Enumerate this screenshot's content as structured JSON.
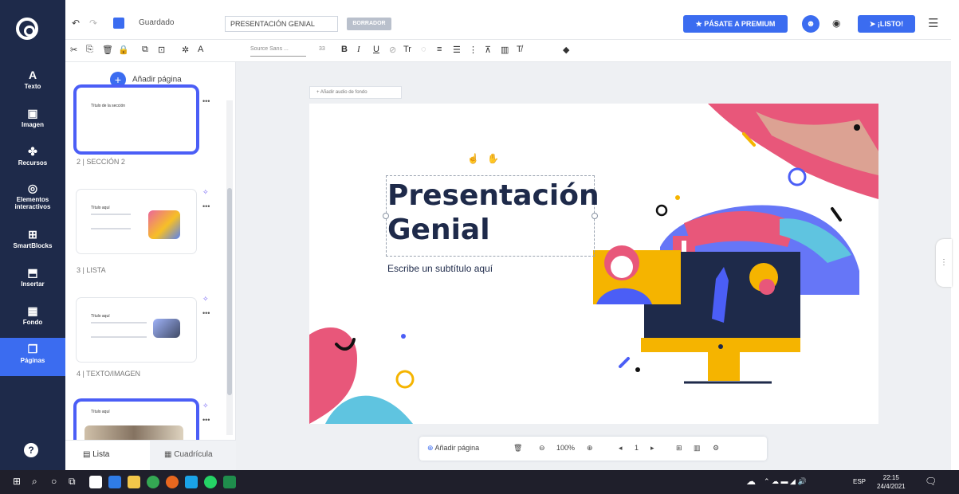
{
  "rail": {
    "items": [
      {
        "label": "Texto",
        "icon": "A"
      },
      {
        "label": "Imagen",
        "icon": "▣"
      },
      {
        "label": "Recursos",
        "icon": "✤"
      },
      {
        "label": "Elementos interactivos",
        "icon": "◎"
      },
      {
        "label": "SmartBlocks",
        "icon": "⊞"
      },
      {
        "label": "Insertar",
        "icon": "⬒"
      },
      {
        "label": "Fondo",
        "icon": "▦"
      },
      {
        "label": "Páginas",
        "icon": "❐"
      }
    ]
  },
  "topbar": {
    "saved_label": "Guardado",
    "title_value": "PRESENTACIÓN GENIAL",
    "draft_badge": "BORRADOR",
    "premium_label": "PÁSATE A PREMIUM",
    "ready_label": "¡LISTO!"
  },
  "fmtbar": {
    "font_value": "Source Sans ...",
    "size_value": "33"
  },
  "pages": {
    "add_label": "Añadir página",
    "thumb1_title": "Título de la sección",
    "sections": [
      "2 | SECCIÓN 2",
      "3 | LISTA",
      "4 | TEXTO/IMAGEN"
    ],
    "thumb2_title": "Título aquí",
    "thumb3_title": "Título aquí",
    "thumb4_title": "Título aquí",
    "view_list": "Lista",
    "view_grid": "Cuadrícula"
  },
  "canvas": {
    "bg_audio": "Añadir audio de fondo",
    "title": "Presentación Genial",
    "title_line1": "Presentación",
    "title_line2": "Genial",
    "subtitle": "Escribe un subtítulo aquí"
  },
  "bottombar": {
    "add_page": "Añadir página",
    "zoom": "100%",
    "page_num": "1"
  },
  "taskbar": {
    "lang": "ESP",
    "time": "22:15",
    "date": "24/4/2021"
  },
  "colors": {
    "primary": "#3b6cf0",
    "rail": "#1e2a4a",
    "title": "#1e2a4a"
  }
}
